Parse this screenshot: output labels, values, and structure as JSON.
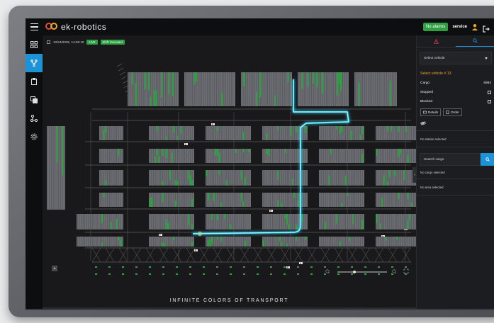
{
  "app": {
    "brand": "ek-robotics"
  },
  "header": {
    "alarm_badge": "No alarms",
    "user": "service"
  },
  "map": {
    "timestamp": "10/24/2025, 14:06:18",
    "live_badge": "LIVE",
    "shift_badge": "Shift: Executed",
    "tagline": "INFINITE COLORS OF TRANSPORT"
  },
  "panel": {
    "vehicle_select": "Select vehicle",
    "selected_title": "Select vehicle # 13",
    "cargo_label": "Cargo",
    "cargo_value": "6984",
    "stopped_label": "Stopped",
    "blocked_label": "Blocked",
    "details_button": "Details",
    "order_button": "Order",
    "station_message": "No station selected",
    "search_placeholder": "Search cargo",
    "cargo_message": "No cargo selected",
    "area_message": "No area selected"
  },
  "icons": {
    "menu": "menu-icon",
    "warning": "warning-icon",
    "search": "search-icon",
    "user": "user-icon",
    "logout": "logout-icon"
  },
  "colors": {
    "accent": "#1d92d6",
    "route": "#38d8f2",
    "status_green": "#2ea043",
    "brand_red": "#e94b3c",
    "brand_orange": "#f3a526",
    "warning_red": "#e03b3b"
  }
}
